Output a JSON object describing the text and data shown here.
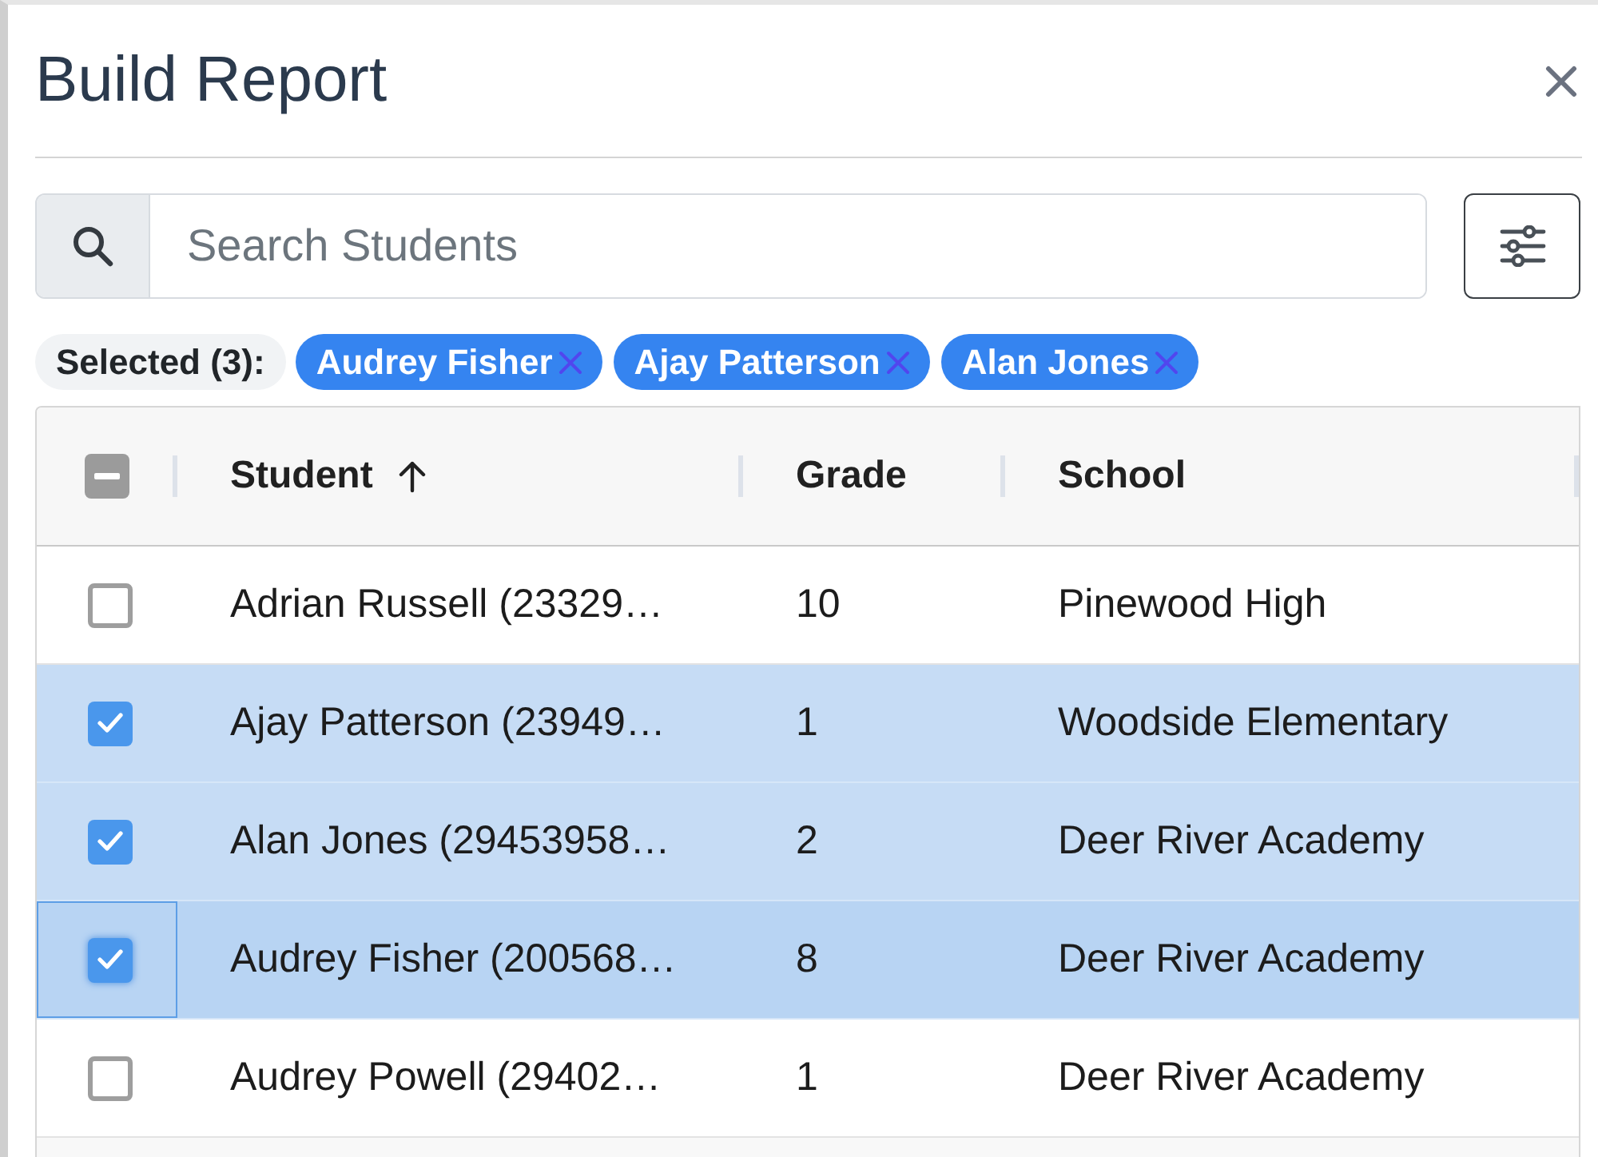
{
  "dialog": {
    "title": "Build Report"
  },
  "search": {
    "placeholder": "Search Students"
  },
  "selection": {
    "label": "Selected (3):",
    "chips": [
      {
        "label": "Audrey Fisher"
      },
      {
        "label": "Ajay Patterson"
      },
      {
        "label": "Alan Jones"
      }
    ]
  },
  "table": {
    "select_all": {
      "indeterminate": true
    },
    "columns": [
      {
        "label": "Student",
        "sorted": true
      },
      {
        "label": "Grade",
        "sorted": false
      },
      {
        "label": "School",
        "sorted": false
      }
    ],
    "rows": [
      {
        "student": "Adrian Russell (23329…",
        "grade": "10",
        "school": "Pinewood High",
        "selected": false,
        "focused": false
      },
      {
        "student": "Ajay Patterson (23949…",
        "grade": "1",
        "school": "Woodside Elementary",
        "selected": true,
        "focused": false
      },
      {
        "student": "Alan Jones (29453958…",
        "grade": "2",
        "school": "Deer River Academy",
        "selected": true,
        "focused": false
      },
      {
        "student": "Audrey Fisher (200568…",
        "grade": "8",
        "school": "Deer River Academy",
        "selected": true,
        "focused": true
      },
      {
        "student": "Audrey Powell (29402…",
        "grade": "1",
        "school": "Deer River Academy",
        "selected": false,
        "focused": false
      }
    ]
  }
}
